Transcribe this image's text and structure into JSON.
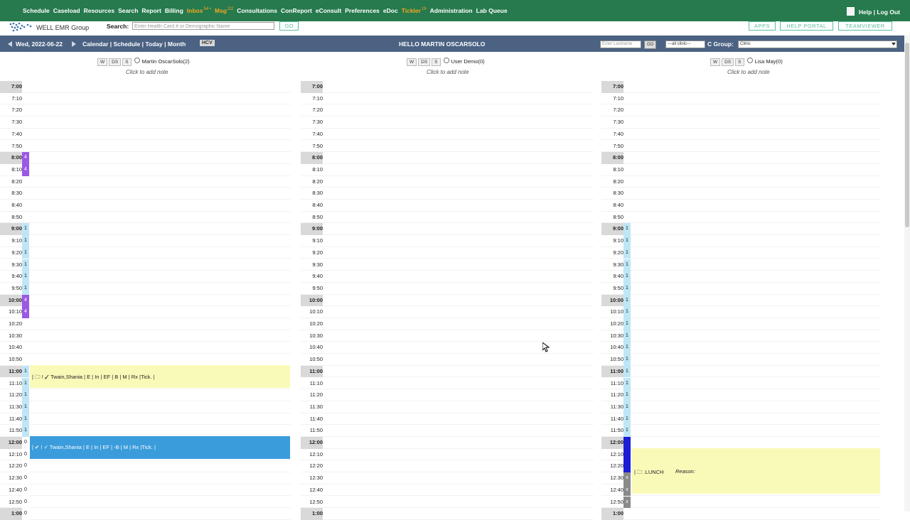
{
  "nav": {
    "items": [
      {
        "label": "Schedule",
        "hl": false
      },
      {
        "label": "Caseload",
        "hl": false
      },
      {
        "label": "Resources",
        "hl": false
      },
      {
        "label": "Search",
        "hl": false
      },
      {
        "label": "Report",
        "hl": false
      },
      {
        "label": "Billing",
        "hl": false
      },
      {
        "label": "Inbox",
        "sup": "54 •",
        "hl": true
      },
      {
        "label": "Msg",
        "sup": "2/2",
        "hl": true
      },
      {
        "label": "Consultations",
        "hl": false
      },
      {
        "label": "ConReport",
        "hl": false
      },
      {
        "label": "eConsult",
        "hl": false
      },
      {
        "label": "Preferences",
        "hl": false
      },
      {
        "label": "eDoc",
        "hl": false
      },
      {
        "label": "Tickler",
        "sup": "19",
        "hl": true
      },
      {
        "label": "Administration",
        "hl": false
      },
      {
        "label": "Lab Queue",
        "hl": false
      }
    ],
    "help": "Help",
    "sep": "|",
    "logout": "Log Out"
  },
  "brand": {
    "name": "WELL EMR Group"
  },
  "search": {
    "label": "Search:",
    "placeholder": "Enter Health Card # or Demographic Name",
    "go": "GO"
  },
  "links": {
    "apps": "APPS",
    "help_portal": "HELP PORTAL",
    "teamviewer": "TEAMVIEWER"
  },
  "datebar": {
    "date": "Wed, 2022-06-22",
    "views": "Calendar | Schedule | Today | Month",
    "hcv": "HCV",
    "greeting": "HELLO MARTIN OSCARSOLO",
    "lastname_placeholder": "Enter Lastname",
    "go": "GO",
    "clinic_select": "---all clinic---",
    "cgroup_label": "C Group:",
    "cgroup_value": "Clinic"
  },
  "colors": {
    "topbar": "#267a4d",
    "bluebar": "#4b6283",
    "highlight": "#f5a623",
    "appt_yellow": "#fafab8",
    "appt_blue": "#3b9cdc",
    "purple": "#9b59e6",
    "lightblue": "#bfe6f7",
    "darkblue": "#1d1dd6",
    "gray": "#8a8a8a"
  },
  "providers": [
    {
      "buttons": [
        "W",
        "DS",
        "S"
      ],
      "name": "Martin OscarSolo(2)",
      "note": "Click to add note"
    },
    {
      "buttons": [
        "W",
        "DS",
        "S"
      ],
      "name": "User Demo(0)",
      "note": "Click to add note"
    },
    {
      "buttons": [
        "W",
        "DS",
        "S"
      ],
      "name": "Lisa May(0)",
      "note": "Click to add note"
    }
  ],
  "times": [
    "7:00",
    "7:10",
    "7:20",
    "7:30",
    "7:40",
    "7:50",
    "8:00",
    "8:10",
    "8:20",
    "8:30",
    "8:40",
    "8:50",
    "9:00",
    "9:10",
    "9:20",
    "9:30",
    "9:40",
    "9:50",
    "10:00",
    "10:10",
    "10:20",
    "10:30",
    "10:40",
    "10:50",
    "11:00",
    "11:10",
    "11:20",
    "11:30",
    "11:40",
    "11:50",
    "12:00",
    "12:10",
    "12:20",
    "12:30",
    "12:40",
    "12:50",
    "1:00"
  ],
  "counts": {
    "col1": [
      "",
      "",
      "",
      "",
      "",
      "",
      "4",
      "4",
      "",
      "",
      "",
      "",
      "1",
      "1",
      "1",
      "1",
      "1",
      "1",
      "4",
      "4",
      "",
      "",
      "",
      "",
      "1",
      "1",
      "1",
      "1",
      "1",
      "1",
      "0",
      "0",
      "0",
      "0",
      "0",
      "0",
      "0"
    ],
    "col3": [
      "",
      "",
      "",
      "",
      "",
      "",
      "",
      "",
      "",
      "",
      "",
      "",
      "1",
      "1",
      "1",
      "1",
      "1",
      "1",
      "1",
      "1",
      "1",
      "1",
      "1",
      "1",
      "1",
      "1",
      "1",
      "1",
      "1",
      "1",
      "",
      "",
      "",
      "x",
      "x",
      "x",
      ""
    ]
  },
  "appointments": {
    "a1": {
      "text": "| 🗀 ! ✓ Twain,Shania | E | In | EF | B | M | Rx |Tick. |"
    },
    "a2": {
      "text": "| ✔ ! ✓ Twain,Shania | E | In | EF | -B | M | Rx |Tick. |"
    },
    "a3": {
      "text": "| 🗀 .LUNCH",
      "reason": "Reason:"
    }
  }
}
